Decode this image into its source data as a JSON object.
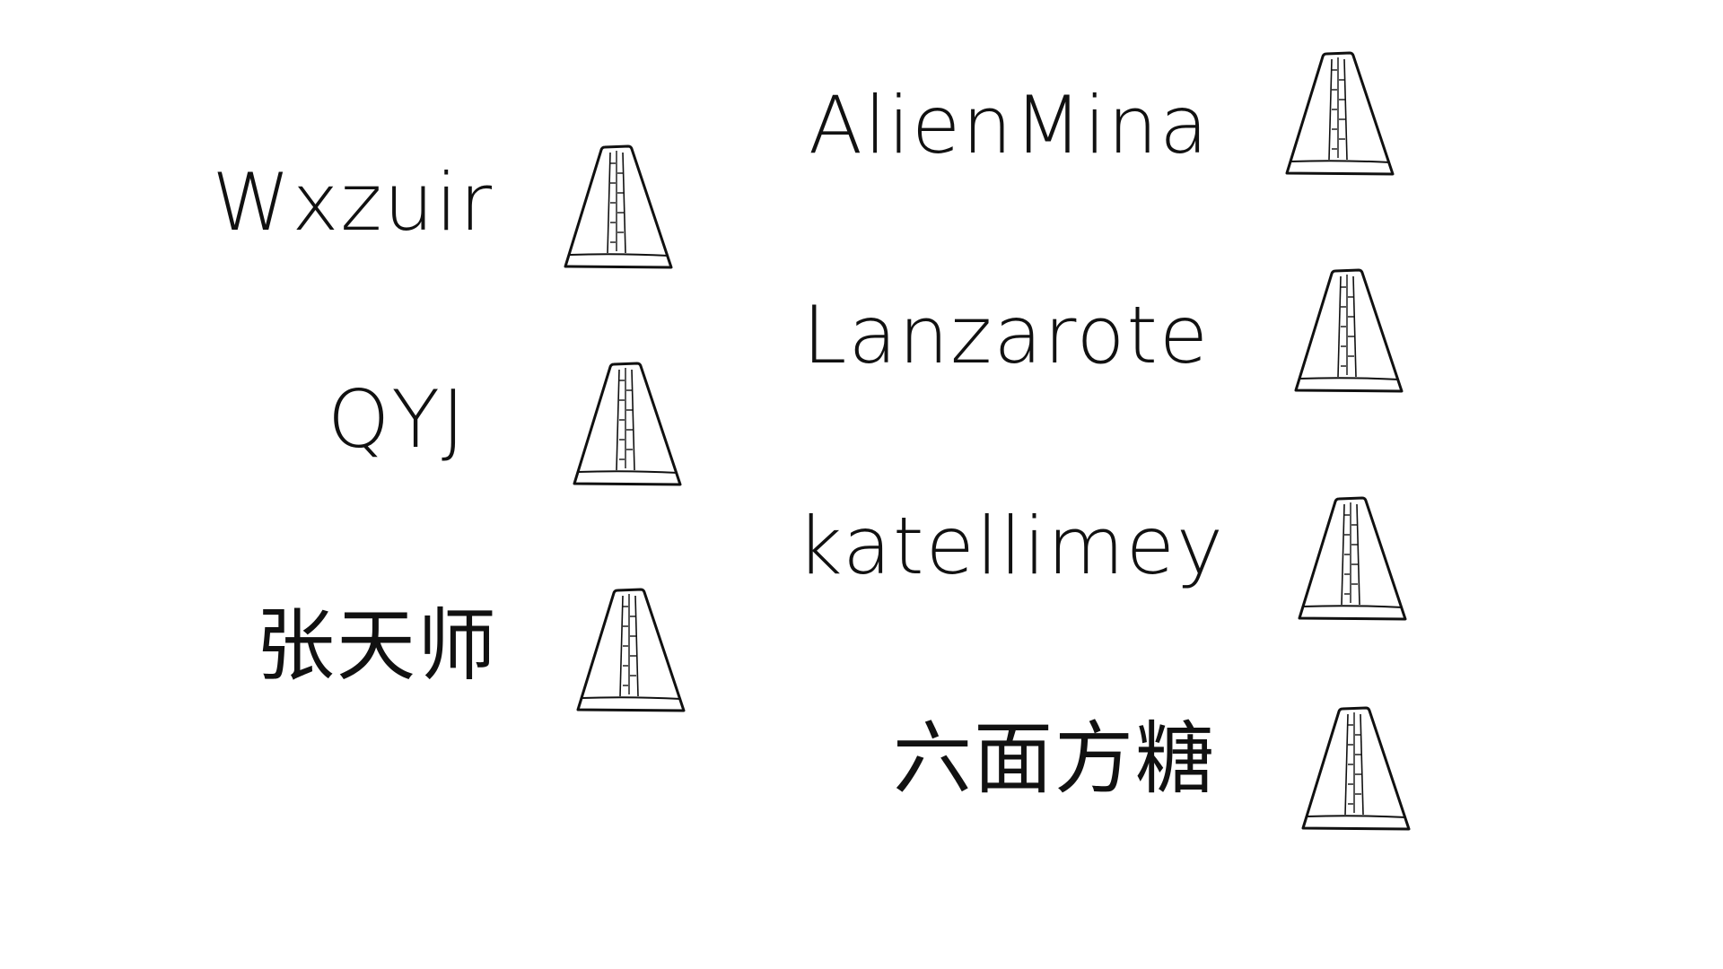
{
  "left_column": [
    {
      "name": "Wxzuir",
      "icon": "metronome-icon"
    },
    {
      "name": "QYJ",
      "icon": "metronome-icon"
    },
    {
      "name": "张天师",
      "icon": "metronome-icon"
    }
  ],
  "right_column": [
    {
      "name": "AlienMina",
      "icon": "metronome-icon"
    },
    {
      "name": "Lanzarote",
      "icon": "metronome-icon"
    },
    {
      "name": "katellimey",
      "icon": "metronome-icon"
    },
    {
      "name": "六面方糖",
      "icon": "metronome-icon"
    }
  ],
  "colors": {
    "ink": "#111111",
    "background": "#ffffff"
  }
}
